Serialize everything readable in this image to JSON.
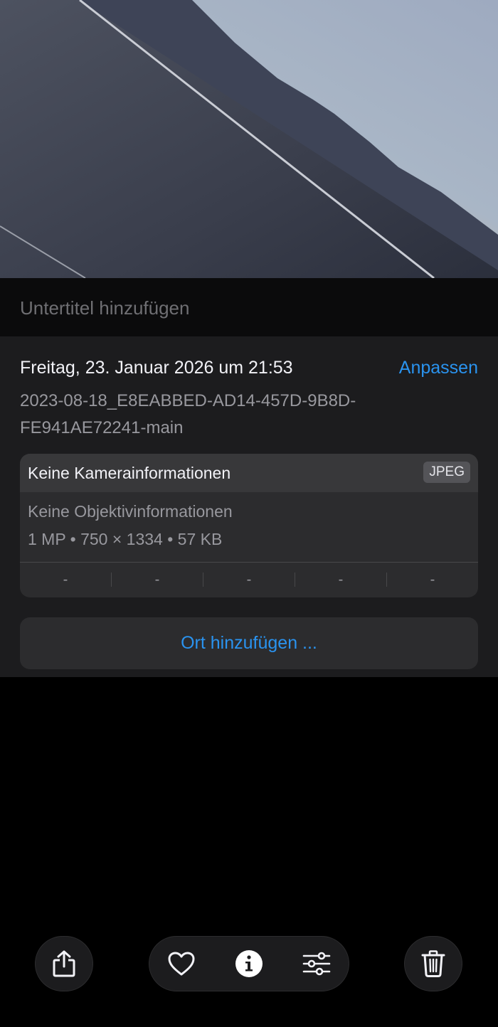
{
  "caption": {
    "placeholder": "Untertitel hinzufügen"
  },
  "info": {
    "date": "Freitag, 23. Januar 2026 um 21:53",
    "adjust_label": "Anpassen",
    "filename": "2023-08-18_E8EABBED-AD14-457D-9B8D-FE941AE72241-main"
  },
  "camera": {
    "title": "Keine Kamerainformationen",
    "format": "JPEG",
    "lens": "Keine Objektivinformationen",
    "specs": "1 MP • 750 × 1334 • 57 KB",
    "exif": [
      "-",
      "-",
      "-",
      "-",
      "-"
    ]
  },
  "location": {
    "button_label": "Ort hinzufügen ..."
  },
  "toolbar": {
    "icons": [
      "share-icon",
      "heart-icon",
      "info-icon",
      "sliders-icon",
      "trash-icon"
    ]
  },
  "colors": {
    "accent": "#2a93ef",
    "panel": "#1c1c1e",
    "card": "#2c2c2e"
  }
}
